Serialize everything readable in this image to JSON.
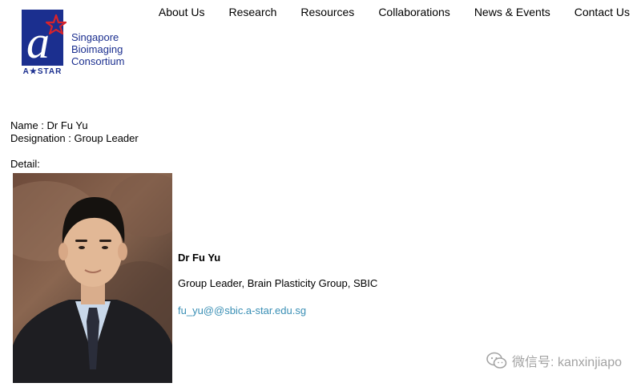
{
  "logo": {
    "mark_letter": "a",
    "agency": "A★STAR",
    "lines": [
      "Singapore",
      "Bioimaging",
      "Consortium"
    ]
  },
  "nav": {
    "items": [
      {
        "label": "About Us"
      },
      {
        "label": "Research"
      },
      {
        "label": "Resources"
      },
      {
        "label": "Collaborations"
      },
      {
        "label": "News & Events"
      },
      {
        "label": "Contact Us"
      }
    ]
  },
  "profile": {
    "name_line": "Name : Dr Fu Yu",
    "designation_line": "Designation : Group Leader",
    "detail_label": "Detail:"
  },
  "bio": {
    "name": "Dr Fu Yu",
    "role": "Group Leader, Brain Plasticity Group, SBIC",
    "email": "fu_yu@@sbic.a-star.edu.sg"
  },
  "watermark": {
    "text": "微信号: kanxinjiapo"
  },
  "colors": {
    "brand_blue": "#1b2f8f",
    "star_red": "#d8232a",
    "link": "#3a8fb5",
    "watermark": "#a3a3a3"
  }
}
